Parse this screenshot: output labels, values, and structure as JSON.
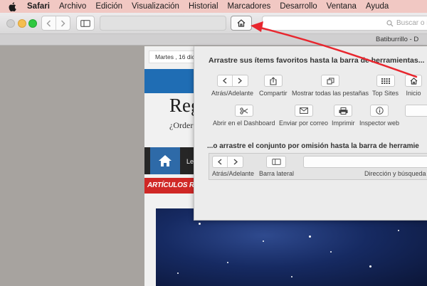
{
  "menubar": {
    "app": "Safari",
    "items": [
      "Archivo",
      "Edición",
      "Visualización",
      "Historial",
      "Marcadores",
      "Desarrollo",
      "Ventana",
      "Ayuda"
    ]
  },
  "toolbar": {
    "search_placeholder": "Buscar o in"
  },
  "tab": {
    "title": "Batiburrillo - D"
  },
  "webpage": {
    "date": "Martes , 16 dic",
    "site_title": "Reg",
    "site_subtitle": "¿Order",
    "nav_item": "Le",
    "section": "ARTÍCULOS RE"
  },
  "panel": {
    "heading": "Arrastre sus ítems favoritos hasta la barra de herramientas...",
    "items": [
      {
        "label": "Atrás/Adelante",
        "icon": "back-forward-icon"
      },
      {
        "label": "Compartir",
        "icon": "share-icon"
      },
      {
        "label": "Mostrar todas las pestañas",
        "icon": "tabs-icon"
      },
      {
        "label": "Top Sites",
        "icon": "grid-icon"
      },
      {
        "label": "Inicio",
        "icon": "home-icon"
      },
      {
        "label": "Abrir en el Dashboard",
        "icon": "scissors-icon"
      },
      {
        "label": "Enviar por correo",
        "icon": "envelope-icon"
      },
      {
        "label": "Imprimir",
        "icon": "printer-icon"
      },
      {
        "label": "Inspector web",
        "icon": "info-icon"
      }
    ],
    "default_heading": "...o arrastre el conjunto por omisión hasta la barra de herramie",
    "default_items": [
      "Atrás/Adelante",
      "Barra lateral",
      "Dirección y búsqueda"
    ]
  },
  "colors": {
    "menubar": "#f1c8c3",
    "arrow": "#e8262e",
    "site_blue": "#1f6db4",
    "site_red": "#d02826"
  }
}
